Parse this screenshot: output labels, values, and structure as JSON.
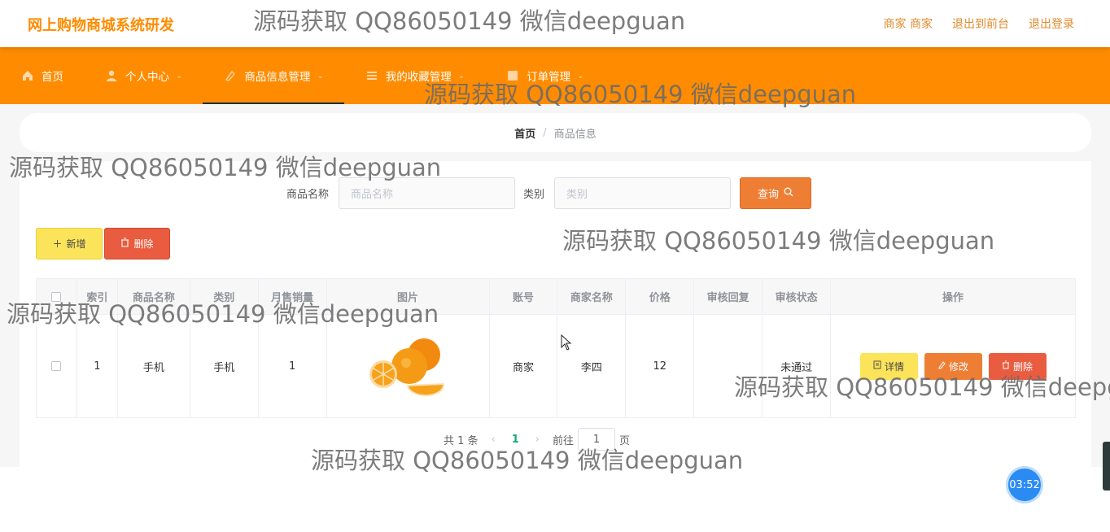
{
  "header": {
    "title": "网上购物商城系统研发",
    "links": [
      "商家 商家",
      "退出到前台",
      "退出登录"
    ]
  },
  "nav": [
    {
      "label": "首页",
      "icon": "home-icon"
    },
    {
      "label": "个人中心",
      "icon": "user-icon"
    },
    {
      "label": "商品信息管理",
      "icon": "goods-icon"
    },
    {
      "label": "我的收藏管理",
      "icon": "collect-icon"
    },
    {
      "label": "订单管理",
      "icon": "order-icon"
    }
  ],
  "breadcrumb": {
    "home": "首页",
    "sep": "/",
    "current": "商品信息"
  },
  "search": {
    "name_label": "商品名称",
    "name_placeholder": "商品名称",
    "category_label": "类别",
    "category_placeholder": "类别",
    "button": "查询"
  },
  "actions": {
    "add": "新增",
    "delete": "删除"
  },
  "table": {
    "headers": [
      "",
      "索引",
      "商品名称",
      "类别",
      "月售销量",
      "图片",
      "账号",
      "商家名称",
      "价格",
      "审核回复",
      "审核状态",
      "操作"
    ],
    "rows": [
      {
        "index": "1",
        "name": "手机",
        "category": "手机",
        "sales": "1",
        "account": "商家",
        "merchant": "李四",
        "price": "12",
        "reply": "",
        "status": "未通过"
      }
    ],
    "ops": {
      "detail": "详情",
      "edit": "修改",
      "delete": "删除"
    }
  },
  "pager": {
    "total": "共 1 条",
    "prev": "‹",
    "current": "1",
    "next": "›",
    "goto": "前往",
    "page_value": "1",
    "page_unit": "页"
  },
  "watermark": "源码获取 QQ86050149 微信deepguan",
  "timer": "03:52",
  "colors": {
    "accent": "#ff8c00",
    "search_button": "#ef7e35",
    "add": "#fbe45a",
    "delete": "#e95c3f"
  }
}
